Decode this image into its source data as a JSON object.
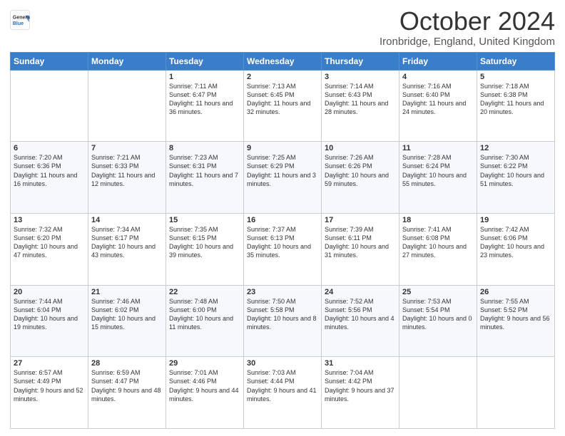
{
  "header": {
    "logo_general": "General",
    "logo_blue": "Blue",
    "month_title": "October 2024",
    "location": "Ironbridge, England, United Kingdom"
  },
  "weekdays": [
    "Sunday",
    "Monday",
    "Tuesday",
    "Wednesday",
    "Thursday",
    "Friday",
    "Saturday"
  ],
  "weeks": [
    [
      {
        "day": "",
        "info": ""
      },
      {
        "day": "",
        "info": ""
      },
      {
        "day": "1",
        "info": "Sunrise: 7:11 AM\nSunset: 6:47 PM\nDaylight: 11 hours and 36 minutes."
      },
      {
        "day": "2",
        "info": "Sunrise: 7:13 AM\nSunset: 6:45 PM\nDaylight: 11 hours and 32 minutes."
      },
      {
        "day": "3",
        "info": "Sunrise: 7:14 AM\nSunset: 6:43 PM\nDaylight: 11 hours and 28 minutes."
      },
      {
        "day": "4",
        "info": "Sunrise: 7:16 AM\nSunset: 6:40 PM\nDaylight: 11 hours and 24 minutes."
      },
      {
        "day": "5",
        "info": "Sunrise: 7:18 AM\nSunset: 6:38 PM\nDaylight: 11 hours and 20 minutes."
      }
    ],
    [
      {
        "day": "6",
        "info": "Sunrise: 7:20 AM\nSunset: 6:36 PM\nDaylight: 11 hours and 16 minutes."
      },
      {
        "day": "7",
        "info": "Sunrise: 7:21 AM\nSunset: 6:33 PM\nDaylight: 11 hours and 12 minutes."
      },
      {
        "day": "8",
        "info": "Sunrise: 7:23 AM\nSunset: 6:31 PM\nDaylight: 11 hours and 7 minutes."
      },
      {
        "day": "9",
        "info": "Sunrise: 7:25 AM\nSunset: 6:29 PM\nDaylight: 11 hours and 3 minutes."
      },
      {
        "day": "10",
        "info": "Sunrise: 7:26 AM\nSunset: 6:26 PM\nDaylight: 10 hours and 59 minutes."
      },
      {
        "day": "11",
        "info": "Sunrise: 7:28 AM\nSunset: 6:24 PM\nDaylight: 10 hours and 55 minutes."
      },
      {
        "day": "12",
        "info": "Sunrise: 7:30 AM\nSunset: 6:22 PM\nDaylight: 10 hours and 51 minutes."
      }
    ],
    [
      {
        "day": "13",
        "info": "Sunrise: 7:32 AM\nSunset: 6:20 PM\nDaylight: 10 hours and 47 minutes."
      },
      {
        "day": "14",
        "info": "Sunrise: 7:34 AM\nSunset: 6:17 PM\nDaylight: 10 hours and 43 minutes."
      },
      {
        "day": "15",
        "info": "Sunrise: 7:35 AM\nSunset: 6:15 PM\nDaylight: 10 hours and 39 minutes."
      },
      {
        "day": "16",
        "info": "Sunrise: 7:37 AM\nSunset: 6:13 PM\nDaylight: 10 hours and 35 minutes."
      },
      {
        "day": "17",
        "info": "Sunrise: 7:39 AM\nSunset: 6:11 PM\nDaylight: 10 hours and 31 minutes."
      },
      {
        "day": "18",
        "info": "Sunrise: 7:41 AM\nSunset: 6:08 PM\nDaylight: 10 hours and 27 minutes."
      },
      {
        "day": "19",
        "info": "Sunrise: 7:42 AM\nSunset: 6:06 PM\nDaylight: 10 hours and 23 minutes."
      }
    ],
    [
      {
        "day": "20",
        "info": "Sunrise: 7:44 AM\nSunset: 6:04 PM\nDaylight: 10 hours and 19 minutes."
      },
      {
        "day": "21",
        "info": "Sunrise: 7:46 AM\nSunset: 6:02 PM\nDaylight: 10 hours and 15 minutes."
      },
      {
        "day": "22",
        "info": "Sunrise: 7:48 AM\nSunset: 6:00 PM\nDaylight: 10 hours and 11 minutes."
      },
      {
        "day": "23",
        "info": "Sunrise: 7:50 AM\nSunset: 5:58 PM\nDaylight: 10 hours and 8 minutes."
      },
      {
        "day": "24",
        "info": "Sunrise: 7:52 AM\nSunset: 5:56 PM\nDaylight: 10 hours and 4 minutes."
      },
      {
        "day": "25",
        "info": "Sunrise: 7:53 AM\nSunset: 5:54 PM\nDaylight: 10 hours and 0 minutes."
      },
      {
        "day": "26",
        "info": "Sunrise: 7:55 AM\nSunset: 5:52 PM\nDaylight: 9 hours and 56 minutes."
      }
    ],
    [
      {
        "day": "27",
        "info": "Sunrise: 6:57 AM\nSunset: 4:49 PM\nDaylight: 9 hours and 52 minutes."
      },
      {
        "day": "28",
        "info": "Sunrise: 6:59 AM\nSunset: 4:47 PM\nDaylight: 9 hours and 48 minutes."
      },
      {
        "day": "29",
        "info": "Sunrise: 7:01 AM\nSunset: 4:46 PM\nDaylight: 9 hours and 44 minutes."
      },
      {
        "day": "30",
        "info": "Sunrise: 7:03 AM\nSunset: 4:44 PM\nDaylight: 9 hours and 41 minutes."
      },
      {
        "day": "31",
        "info": "Sunrise: 7:04 AM\nSunset: 4:42 PM\nDaylight: 9 hours and 37 minutes."
      },
      {
        "day": "",
        "info": ""
      },
      {
        "day": "",
        "info": ""
      }
    ]
  ]
}
